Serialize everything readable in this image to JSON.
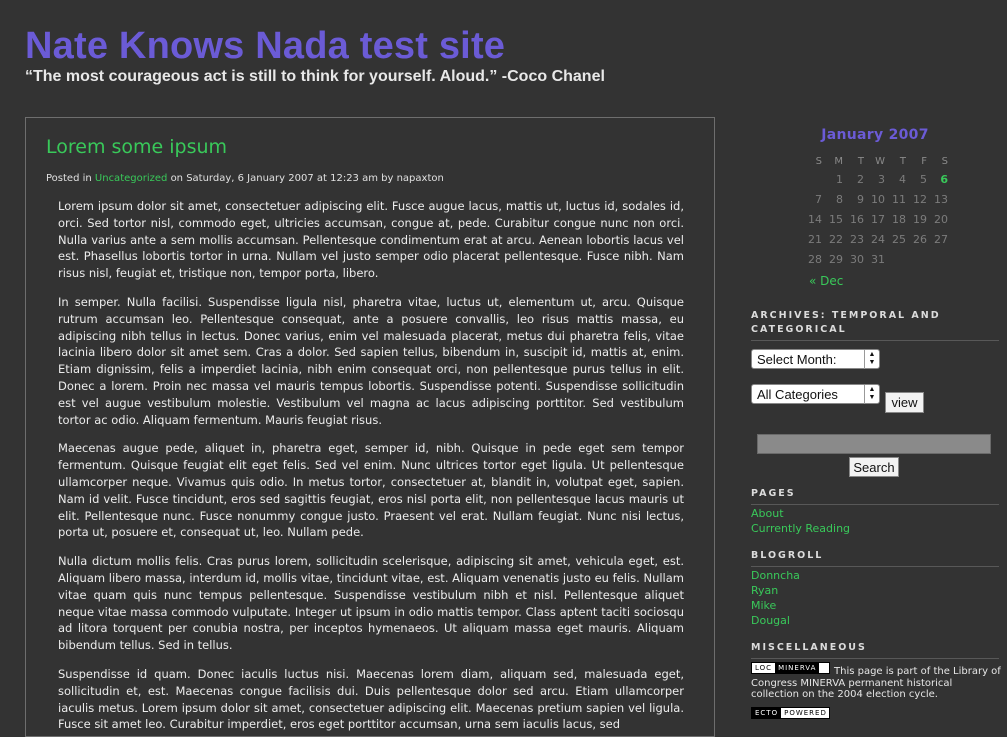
{
  "header": {
    "site_title": "Nate Knows Nada test site",
    "tagline": "“The most courageous act is still to think for yourself. Aloud.” -Coco Chanel"
  },
  "post": {
    "title": "Lorem some ipsum",
    "meta_prefix": "Posted in",
    "category": "Uncategorized",
    "meta_suffix": "on Saturday, 6 January 2007 at 12:23 am by napaxton",
    "paragraphs": [
      "Lorem ipsum dolor sit amet, consectetuer adipiscing elit. Fusce augue lacus, mattis ut, luctus id, sodales id, orci. Sed tortor nisl, commodo eget, ultricies accumsan, congue at, pede. Curabitur congue nunc non orci. Nulla varius ante a sem mollis accumsan. Pellentesque condimentum erat at arcu. Aenean lobortis lacus vel est. Phasellus lobortis tortor in urna. Nullam vel justo semper odio placerat pellentesque. Fusce nibh. Nam risus nisl, feugiat et, tristique non, tempor porta, libero.",
      "In semper. Nulla facilisi. Suspendisse ligula nisl, pharetra vitae, luctus ut, elementum ut, arcu. Quisque rutrum accumsan leo. Pellentesque consequat, ante a posuere convallis, leo risus mattis massa, eu adipiscing nibh tellus in lectus. Donec varius, enim vel malesuada placerat, metus dui pharetra felis, vitae lacinia libero dolor sit amet sem. Cras a dolor. Sed sapien tellus, bibendum in, suscipit id, mattis at, enim. Etiam dignissim, felis a imperdiet lacinia, nibh enim consequat orci, non pellentesque purus tellus in elit. Donec a lorem. Proin nec massa vel mauris tempus lobortis. Suspendisse potenti. Suspendisse sollicitudin est vel augue vestibulum molestie. Vestibulum vel magna ac lacus adipiscing porttitor. Sed vestibulum tortor ac odio. Aliquam fermentum. Mauris feugiat risus.",
      "Maecenas augue pede, aliquet in, pharetra eget, semper id, nibh. Quisque in pede eget sem tempor fermentum. Quisque feugiat elit eget felis. Sed vel enim. Nunc ultrices tortor eget ligula. Ut pellentesque ullamcorper neque. Vivamus quis odio. In metus tortor, consectetuer at, blandit in, volutpat eget, sapien. Nam id velit. Fusce tincidunt, eros sed sagittis feugiat, eros nisl porta elit, non pellentesque lacus mauris ut elit. Pellentesque nunc. Fusce nonummy congue justo. Praesent vel erat. Nullam feugiat. Nunc nisi lectus, porta ut, posuere et, consequat ut, leo. Nullam pede.",
      "Nulla dictum mollis felis. Cras purus lorem, sollicitudin scelerisque, adipiscing sit amet, vehicula eget, est. Aliquam libero massa, interdum id, mollis vitae, tincidunt vitae, est. Aliquam venenatis justo eu felis. Nullam vitae quam quis nunc tempus pellentesque. Suspendisse vestibulum nibh et nisl. Pellentesque aliquet neque vitae massa commodo vulputate. Integer ut ipsum in odio mattis tempor. Class aptent taciti sociosqu ad litora torquent per conubia nostra, per inceptos hymenaeos. Ut aliquam massa eget mauris. Aliquam bibendum tellus. Sed in tellus.",
      "Suspendisse id quam. Donec iaculis luctus nisi. Maecenas lorem diam, aliquam sed, malesuada eget, sollicitudin et, est. Maecenas congue facilisis dui. Duis pellentesque dolor sed arcu. Etiam ullamcorper iaculis metus. Lorem ipsum dolor sit amet, consectetuer adipiscing elit. Maecenas pretium sapien vel ligula. Fusce sit amet leo. Curabitur imperdiet, eros eget porttitor accumsan, urna sem iaculis lacus, sed"
    ]
  },
  "sidebar": {
    "calendar": {
      "caption": "January 2007",
      "weekdays": [
        "S",
        "M",
        "T",
        "W",
        "T",
        "F",
        "S"
      ],
      "weeks": [
        [
          "",
          "1",
          "2",
          "3",
          "4",
          "5",
          "6"
        ],
        [
          "7",
          "8",
          "9",
          "10",
          "11",
          "12",
          "13"
        ],
        [
          "14",
          "15",
          "16",
          "17",
          "18",
          "19",
          "20"
        ],
        [
          "21",
          "22",
          "23",
          "24",
          "25",
          "26",
          "27"
        ],
        [
          "28",
          "29",
          "30",
          "31",
          "",
          "",
          ""
        ]
      ],
      "linked_day": "6",
      "prev_link": "« Dec"
    },
    "archives_heading": "Archives: Temporal and Categorical",
    "month_select": "Select Month:",
    "category_select": "All Categories",
    "view_button": "view",
    "search_button": "Search",
    "pages_heading": "Pages",
    "pages": [
      "About",
      "Currently Reading"
    ],
    "blogroll_heading": "Blogroll",
    "blogroll": [
      "Donncha",
      "Ryan",
      "Mike",
      "Dougal"
    ],
    "misc_heading": "Miscellaneous",
    "loc_badge": {
      "left": "LOC",
      "right": "MINERVA"
    },
    "misc_text": "This page is part of the Library of Congress MINERVA permanent historical collection on the 2004 election cycle.",
    "ecto_badge": {
      "left": "ECTO",
      "right": "POWERED"
    }
  },
  "colors": {
    "background": "#333333",
    "title": "#6b5bd6",
    "link": "#39c95a"
  }
}
